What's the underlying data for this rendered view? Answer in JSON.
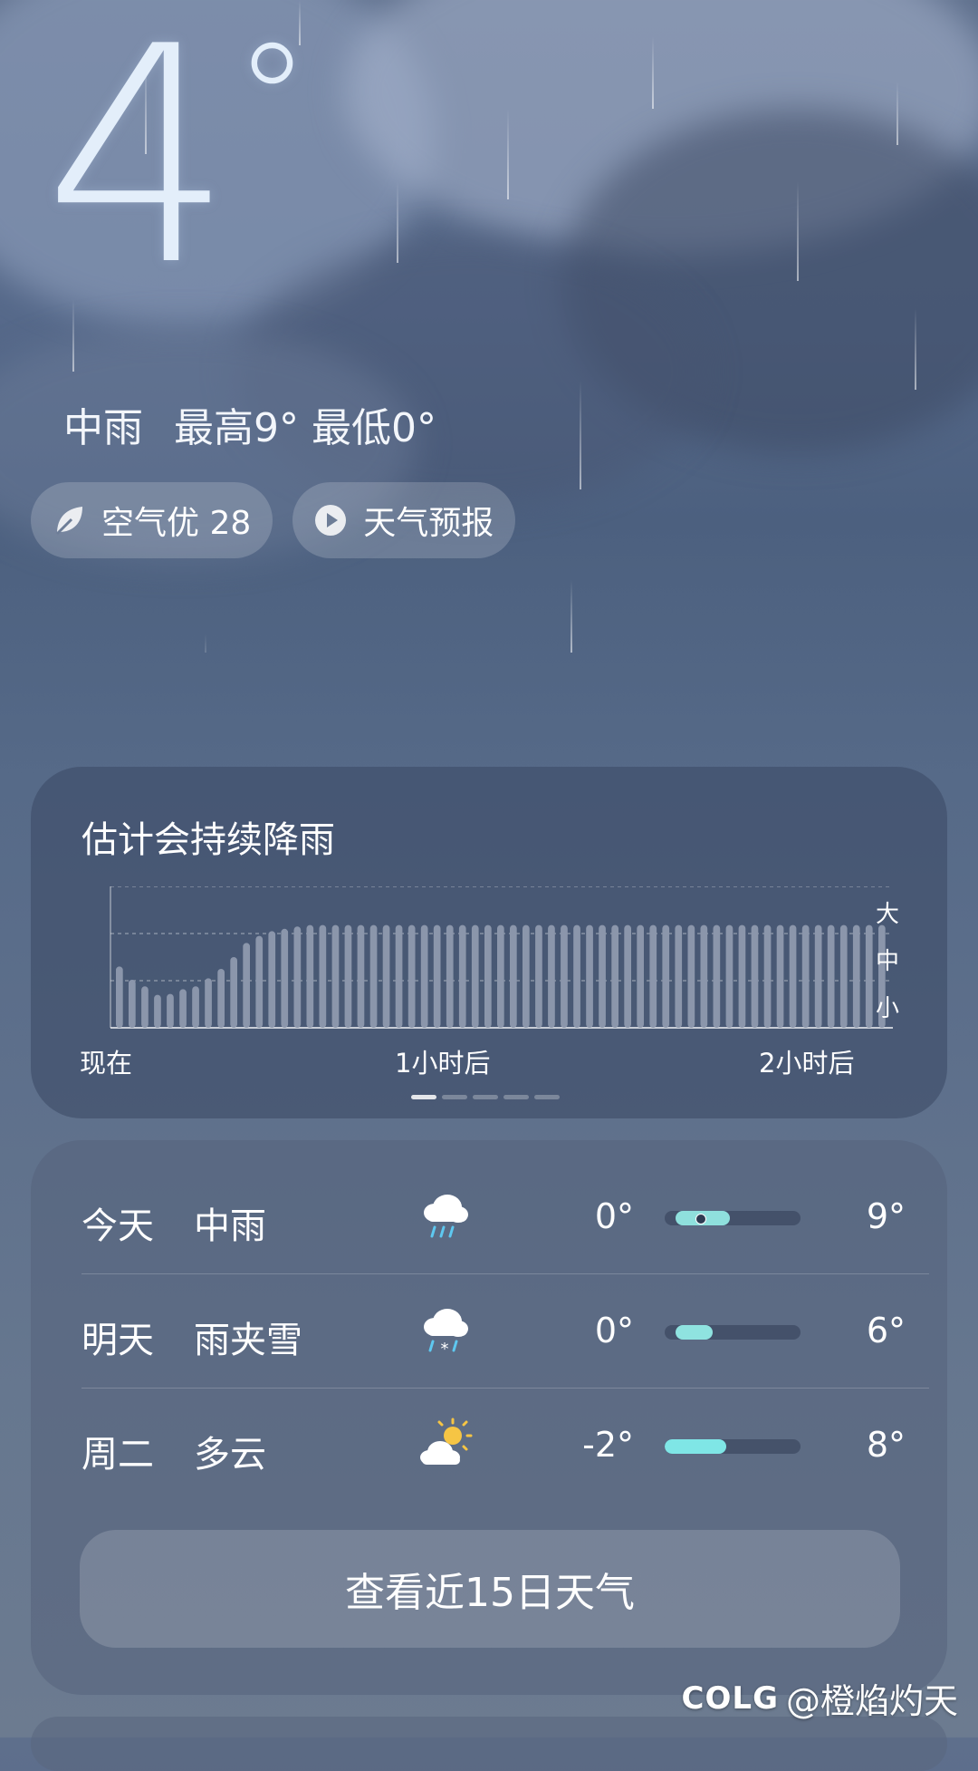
{
  "current": {
    "temperature": "4",
    "degree_symbol": "°",
    "condition": "中雨",
    "high": "最高9°",
    "low": "最低0°"
  },
  "pills": {
    "air_quality": "空气优 28",
    "forecast_video": "天气预报"
  },
  "precipitation": {
    "title": "估计会持续降雨",
    "y_labels": [
      "大",
      "中",
      "小"
    ],
    "x_labels": [
      "现在",
      "1小时后",
      "2小时后"
    ]
  },
  "chart_data": {
    "type": "bar",
    "title": "估计会持续降雨",
    "xlabel": "",
    "ylabel": "",
    "x_tick_labels": [
      "现在",
      "1小时后",
      "2小时后"
    ],
    "y_tick_labels": [
      "小",
      "中",
      "大"
    ],
    "ylim": [
      0,
      3
    ],
    "values": [
      1.3,
      1.02,
      0.88,
      0.7,
      0.72,
      0.82,
      0.88,
      1.05,
      1.25,
      1.5,
      1.8,
      1.95,
      2.05,
      2.1,
      2.15,
      2.18,
      2.18,
      2.18,
      2.18,
      2.18,
      2.18,
      2.18,
      2.18,
      2.18,
      2.18,
      2.18,
      2.18,
      2.18,
      2.18,
      2.18,
      2.18,
      2.18,
      2.18,
      2.18,
      2.18,
      2.18,
      2.18,
      2.18,
      2.18,
      2.18,
      2.18,
      2.18,
      2.18,
      2.18,
      2.18,
      2.18,
      2.18,
      2.18,
      2.18,
      2.18,
      2.18,
      2.18,
      2.18,
      2.18,
      2.18,
      2.18,
      2.18,
      2.18,
      2.18,
      2.18,
      2.18
    ],
    "grid": true,
    "bar_color": "#8b96ab"
  },
  "forecast": {
    "days": [
      {
        "name": "今天",
        "condition": "中雨",
        "icon": "rain-cloud-icon",
        "low": "0°",
        "high": "9°",
        "range_start": 0.08,
        "range_end": 0.48,
        "current_marker": 0.26,
        "fill_color": "#8fe0dd"
      },
      {
        "name": "明天",
        "condition": "雨夹雪",
        "icon": "sleet-cloud-icon",
        "low": "0°",
        "high": "6°",
        "range_start": 0.08,
        "range_end": 0.35,
        "fill_color": "#8fe3e0"
      },
      {
        "name": "周二",
        "condition": "多云",
        "icon": "partly-cloudy-icon",
        "low": "-2°",
        "high": "8°",
        "range_start": 0.0,
        "range_end": 0.45,
        "fill_color": "#7fe6e6"
      }
    ],
    "more_button": "查看近15日天气"
  },
  "watermark": {
    "logo": "COLG",
    "handle": "@橙焰灼天"
  }
}
